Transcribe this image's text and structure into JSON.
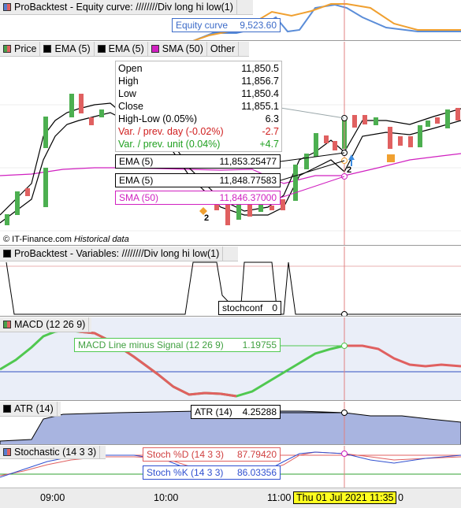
{
  "equity_panel": {
    "title": "ProBacktest - Equity curve: ////////Div long hi low(1)",
    "value_label": "Equity curve",
    "value": "9,523.60"
  },
  "price_panel": {
    "tags": [
      "Price",
      "EMA (5)",
      "EMA (5)",
      "SMA (50)",
      "Other"
    ],
    "ohlc": {
      "open_label": "Open",
      "open": "11,850.5",
      "high_label": "High",
      "high": "11,856.7",
      "low_label": "Low",
      "low": "11,850.4",
      "close_label": "Close",
      "close": "11,855.1",
      "hl_label": "High-Low (0.05%)",
      "hl": "6.3",
      "var_day_label": "Var. / prev. day (-0.02%)",
      "var_day": "-2.7",
      "var_unit_label": "Var. / prev. unit (0.04%)",
      "var_unit": "+4.7"
    },
    "ema1_label": "EMA (5)",
    "ema1_value": "11,853.25477",
    "ema2_label": "EMA (5)",
    "ema2_value": "11,848.77583",
    "sma_label": "SMA (50)",
    "sma_value": "11,846.37000",
    "marker_left": "2",
    "marker_right": "2",
    "copyright": "© IT-Finance.com",
    "historical": "Historical data"
  },
  "variables_panel": {
    "title": "ProBacktest - Variables: ////////Div long hi low(1)",
    "label": "stochconf",
    "value": "0"
  },
  "macd_panel": {
    "title": "MACD (12 26 9)",
    "label": "MACD Line minus Signal (12 26 9)",
    "value": "1.19755"
  },
  "atr_panel": {
    "title": "ATR (14)",
    "label": "ATR (14)",
    "value": "4.25288"
  },
  "stoch_panel": {
    "title": "Stochastic (14 3 3)",
    "d_label": "Stoch %D (14 3 3)",
    "d_value": "87.79420",
    "k_label": "Stoch %K (14 3 3)",
    "k_value": "86.03356"
  },
  "time_axis": {
    "ticks": [
      "09:00",
      "10:00",
      "11:00",
      "0"
    ],
    "cursor_date": "Thu 01 Jul 2021 11:35"
  },
  "colors": {
    "up_candle": "#4caf50",
    "down_candle": "#e06060",
    "sma": "#d020c0",
    "macd_up": "#50c850",
    "macd_down": "#e06060",
    "cursor": "#e08080"
  }
}
